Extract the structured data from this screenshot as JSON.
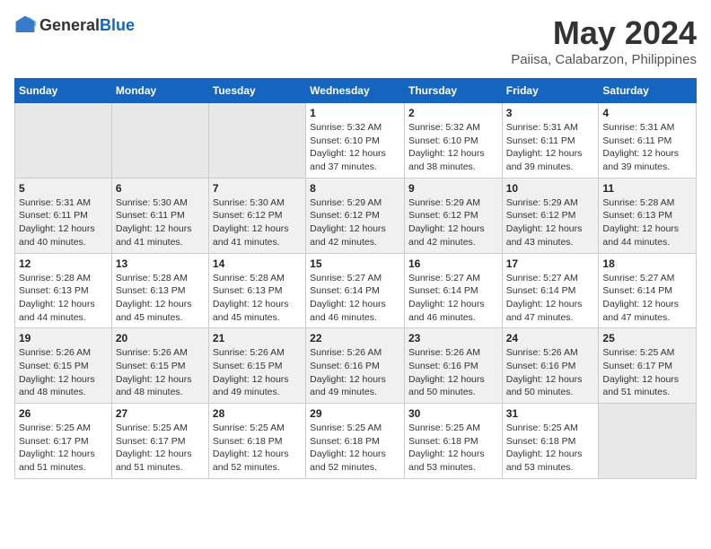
{
  "header": {
    "logo_general": "General",
    "logo_blue": "Blue",
    "title": "May 2024",
    "subtitle": "Paiisa, Calabarzon, Philippines"
  },
  "calendar": {
    "days_of_week": [
      "Sunday",
      "Monday",
      "Tuesday",
      "Wednesday",
      "Thursday",
      "Friday",
      "Saturday"
    ],
    "weeks": [
      [
        {
          "day": "",
          "info": ""
        },
        {
          "day": "",
          "info": ""
        },
        {
          "day": "",
          "info": ""
        },
        {
          "day": "1",
          "info": "Sunrise: 5:32 AM\nSunset: 6:10 PM\nDaylight: 12 hours\nand 37 minutes."
        },
        {
          "day": "2",
          "info": "Sunrise: 5:32 AM\nSunset: 6:10 PM\nDaylight: 12 hours\nand 38 minutes."
        },
        {
          "day": "3",
          "info": "Sunrise: 5:31 AM\nSunset: 6:11 PM\nDaylight: 12 hours\nand 39 minutes."
        },
        {
          "day": "4",
          "info": "Sunrise: 5:31 AM\nSunset: 6:11 PM\nDaylight: 12 hours\nand 39 minutes."
        }
      ],
      [
        {
          "day": "5",
          "info": "Sunrise: 5:31 AM\nSunset: 6:11 PM\nDaylight: 12 hours\nand 40 minutes."
        },
        {
          "day": "6",
          "info": "Sunrise: 5:30 AM\nSunset: 6:11 PM\nDaylight: 12 hours\nand 41 minutes."
        },
        {
          "day": "7",
          "info": "Sunrise: 5:30 AM\nSunset: 6:12 PM\nDaylight: 12 hours\nand 41 minutes."
        },
        {
          "day": "8",
          "info": "Sunrise: 5:29 AM\nSunset: 6:12 PM\nDaylight: 12 hours\nand 42 minutes."
        },
        {
          "day": "9",
          "info": "Sunrise: 5:29 AM\nSunset: 6:12 PM\nDaylight: 12 hours\nand 42 minutes."
        },
        {
          "day": "10",
          "info": "Sunrise: 5:29 AM\nSunset: 6:12 PM\nDaylight: 12 hours\nand 43 minutes."
        },
        {
          "day": "11",
          "info": "Sunrise: 5:28 AM\nSunset: 6:13 PM\nDaylight: 12 hours\nand 44 minutes."
        }
      ],
      [
        {
          "day": "12",
          "info": "Sunrise: 5:28 AM\nSunset: 6:13 PM\nDaylight: 12 hours\nand 44 minutes."
        },
        {
          "day": "13",
          "info": "Sunrise: 5:28 AM\nSunset: 6:13 PM\nDaylight: 12 hours\nand 45 minutes."
        },
        {
          "day": "14",
          "info": "Sunrise: 5:28 AM\nSunset: 6:13 PM\nDaylight: 12 hours\nand 45 minutes."
        },
        {
          "day": "15",
          "info": "Sunrise: 5:27 AM\nSunset: 6:14 PM\nDaylight: 12 hours\nand 46 minutes."
        },
        {
          "day": "16",
          "info": "Sunrise: 5:27 AM\nSunset: 6:14 PM\nDaylight: 12 hours\nand 46 minutes."
        },
        {
          "day": "17",
          "info": "Sunrise: 5:27 AM\nSunset: 6:14 PM\nDaylight: 12 hours\nand 47 minutes."
        },
        {
          "day": "18",
          "info": "Sunrise: 5:27 AM\nSunset: 6:14 PM\nDaylight: 12 hours\nand 47 minutes."
        }
      ],
      [
        {
          "day": "19",
          "info": "Sunrise: 5:26 AM\nSunset: 6:15 PM\nDaylight: 12 hours\nand 48 minutes."
        },
        {
          "day": "20",
          "info": "Sunrise: 5:26 AM\nSunset: 6:15 PM\nDaylight: 12 hours\nand 48 minutes."
        },
        {
          "day": "21",
          "info": "Sunrise: 5:26 AM\nSunset: 6:15 PM\nDaylight: 12 hours\nand 49 minutes."
        },
        {
          "day": "22",
          "info": "Sunrise: 5:26 AM\nSunset: 6:16 PM\nDaylight: 12 hours\nand 49 minutes."
        },
        {
          "day": "23",
          "info": "Sunrise: 5:26 AM\nSunset: 6:16 PM\nDaylight: 12 hours\nand 50 minutes."
        },
        {
          "day": "24",
          "info": "Sunrise: 5:26 AM\nSunset: 6:16 PM\nDaylight: 12 hours\nand 50 minutes."
        },
        {
          "day": "25",
          "info": "Sunrise: 5:25 AM\nSunset: 6:17 PM\nDaylight: 12 hours\nand 51 minutes."
        }
      ],
      [
        {
          "day": "26",
          "info": "Sunrise: 5:25 AM\nSunset: 6:17 PM\nDaylight: 12 hours\nand 51 minutes."
        },
        {
          "day": "27",
          "info": "Sunrise: 5:25 AM\nSunset: 6:17 PM\nDaylight: 12 hours\nand 51 minutes."
        },
        {
          "day": "28",
          "info": "Sunrise: 5:25 AM\nSunset: 6:18 PM\nDaylight: 12 hours\nand 52 minutes."
        },
        {
          "day": "29",
          "info": "Sunrise: 5:25 AM\nSunset: 6:18 PM\nDaylight: 12 hours\nand 52 minutes."
        },
        {
          "day": "30",
          "info": "Sunrise: 5:25 AM\nSunset: 6:18 PM\nDaylight: 12 hours\nand 53 minutes."
        },
        {
          "day": "31",
          "info": "Sunrise: 5:25 AM\nSunset: 6:18 PM\nDaylight: 12 hours\nand 53 minutes."
        },
        {
          "day": "",
          "info": ""
        }
      ]
    ]
  }
}
